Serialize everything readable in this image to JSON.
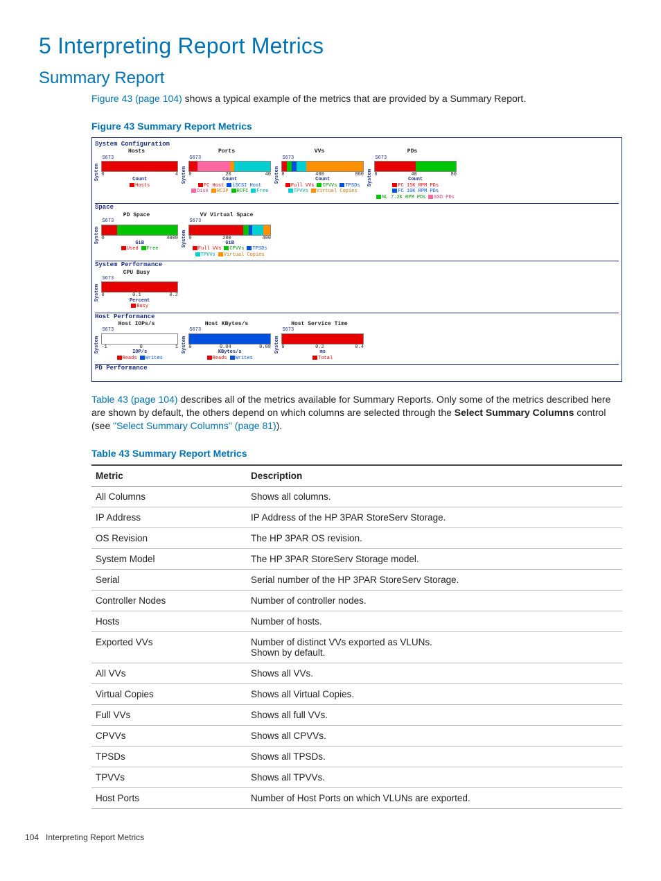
{
  "page": {
    "title": "5 Interpreting Report Metrics",
    "section": "Summary Report",
    "intro_link": "Figure 43 (page 104)",
    "intro_rest": " shows a typical example of the metrics that are provided by a Summary Report.",
    "figure_label": "Figure 43 Summary Report Metrics",
    "mid_link": "Table 43 (page 104)",
    "mid_rest": " describes all of the metrics available for Summary Reports. Only some of the metrics described here are shown by default, the others depend on which columns are selected through the ",
    "mid_bold": "Select Summary Columns",
    "mid_after_bold": " control (see ",
    "mid_link2": "\"Select Summary Columns\" (page 81)",
    "mid_close": ").",
    "table_label": "Table 43 Summary Report Metrics",
    "footer_page": "104",
    "footer_text": "Interpreting Report Metrics"
  },
  "figure": {
    "sections": {
      "sysconf": "System Configuration",
      "space": "Space",
      "sysperf": "System Performance",
      "hostperf": "Host Performance",
      "pdperf": "PD Performance"
    },
    "ylabel": "System",
    "row_label": "S673",
    "hosts": {
      "title": "Hosts",
      "axis_label": "Count",
      "ticks": [
        "0",
        "4"
      ],
      "legend": [
        {
          "c": "red",
          "t": "Hosts"
        }
      ]
    },
    "ports": {
      "title": "Ports",
      "axis_label": "Count",
      "ticks": [
        "0",
        "20",
        "40"
      ],
      "legend": [
        {
          "c": "red",
          "t": "FC Host"
        },
        {
          "c": "blue",
          "t": "iSCSI Host"
        },
        {
          "c": "pink",
          "t": "Disk"
        },
        {
          "c": "orange",
          "t": "RCIP"
        },
        {
          "c": "green",
          "t": "RCFC"
        },
        {
          "c": "cyan",
          "t": "Free"
        }
      ]
    },
    "vvs": {
      "title": "VVs",
      "axis_label": "Count",
      "ticks": [
        "0",
        "400",
        "800"
      ],
      "legend": [
        {
          "c": "red",
          "t": "Full VVs"
        },
        {
          "c": "green",
          "t": "CPVVs"
        },
        {
          "c": "blue",
          "t": "TPSDs"
        },
        {
          "c": "cyan",
          "t": "TPVVs"
        },
        {
          "c": "orange",
          "t": "Virtual Copies"
        }
      ]
    },
    "pds": {
      "title": "PDs",
      "axis_label": "Count",
      "ticks": [
        "0",
        "40",
        "80"
      ],
      "legend": [
        {
          "c": "red",
          "t": "FC 15K RPM PDs"
        },
        {
          "c": "blue",
          "t": "FC 10K RPM PDs"
        },
        {
          "c": "green",
          "t": "NL 7.2K RPM PDs"
        },
        {
          "c": "pink",
          "t": "SSD PDs"
        }
      ]
    },
    "pdspace": {
      "title": "PD Space",
      "axis_label": "GiB",
      "ticks": [
        "0",
        "4000"
      ],
      "legend": [
        {
          "c": "red",
          "t": "Used"
        },
        {
          "c": "green",
          "t": "Free"
        }
      ]
    },
    "vvspace": {
      "title": "VV Virtual Space",
      "axis_label": "GiB",
      "ticks": [
        "0",
        "200",
        "400"
      ],
      "legend": [
        {
          "c": "red",
          "t": "Full VVs"
        },
        {
          "c": "green",
          "t": "CPVVs"
        },
        {
          "c": "blue",
          "t": "TPSDs"
        },
        {
          "c": "cyan",
          "t": "TPVVs"
        },
        {
          "c": "orange",
          "t": "Virtual Copies"
        }
      ]
    },
    "cpu": {
      "title": "CPU Busy",
      "axis_label": "Percent",
      "ticks": [
        "0",
        "0.1",
        "0.2"
      ],
      "legend": [
        {
          "c": "red",
          "t": "Busy"
        }
      ]
    },
    "hiops": {
      "title": "Host IOPs/s",
      "axis_label": "IOP/s",
      "ticks": [
        "-1",
        "0",
        "1"
      ],
      "legend": [
        {
          "c": "red",
          "t": "Reads"
        },
        {
          "c": "blue",
          "t": "Writes"
        }
      ]
    },
    "hkb": {
      "title": "Host KBytes/s",
      "axis_label": "KBytes/s",
      "ticks": [
        "0",
        "0.04",
        "0.08"
      ],
      "legend": [
        {
          "c": "red",
          "t": "Reads"
        },
        {
          "c": "blue",
          "t": "Writes"
        }
      ]
    },
    "hsvc": {
      "title": "Host Service Time",
      "axis_label": "ms",
      "ticks": [
        "0",
        "0.2",
        "0.4"
      ],
      "legend": [
        {
          "c": "red",
          "t": "Total"
        }
      ]
    }
  },
  "table": {
    "headers": {
      "metric": "Metric",
      "desc": "Description"
    },
    "rows": [
      {
        "m": "All Columns",
        "d": "Shows all columns."
      },
      {
        "m": "IP Address",
        "d": "IP Address of the HP 3PAR StoreServ Storage."
      },
      {
        "m": "OS Revision",
        "d": "The HP 3PAR OS revision."
      },
      {
        "m": "System Model",
        "d": "The HP 3PAR StoreServ Storage model."
      },
      {
        "m": "Serial",
        "d": "Serial number of the HP 3PAR StoreServ Storage."
      },
      {
        "m": "Controller Nodes",
        "d": "Number of controller nodes."
      },
      {
        "m": "Hosts",
        "d": "Number of hosts."
      },
      {
        "m": "Exported VVs",
        "d": "Number of distinct VVs exported as VLUNs.",
        "d2": "Shown by default."
      },
      {
        "m": "All VVs",
        "d": "Shows all VVs."
      },
      {
        "m": "Virtual Copies",
        "d": "Shows all Virtual Copies."
      },
      {
        "m": "Full VVs",
        "d": "Shows all full VVs."
      },
      {
        "m": "CPVVs",
        "d": "Shows all CPVVs."
      },
      {
        "m": "TPSDs",
        "d": "Shows all TPSDs."
      },
      {
        "m": "TPVVs",
        "d": "Shows all TPVVs."
      },
      {
        "m": "Host Ports",
        "d": "Number of Host Ports on which VLUNs are exported."
      }
    ]
  },
  "chart_data": [
    {
      "type": "bar",
      "title": "Hosts",
      "xlabel": "Count",
      "categories": [
        "S673"
      ],
      "series": [
        {
          "name": "Hosts",
          "values": [
            5
          ]
        }
      ],
      "xlim": [
        0,
        5
      ]
    },
    {
      "type": "bar",
      "title": "Ports",
      "xlabel": "Count",
      "categories": [
        "S673"
      ],
      "series": [
        {
          "name": "FC Host",
          "values": [
            4
          ]
        },
        {
          "name": "iSCSI Host",
          "values": [
            0
          ]
        },
        {
          "name": "Disk",
          "values": [
            16
          ]
        },
        {
          "name": "RCIP",
          "values": [
            2
          ]
        },
        {
          "name": "RCFC",
          "values": [
            0
          ]
        },
        {
          "name": "Free",
          "values": [
            18
          ]
        }
      ],
      "xlim": [
        0,
        40
      ]
    },
    {
      "type": "bar",
      "title": "VVs",
      "xlabel": "Count",
      "categories": [
        "S673"
      ],
      "series": [
        {
          "name": "Full VVs",
          "values": [
            50
          ]
        },
        {
          "name": "CPVVs",
          "values": [
            50
          ]
        },
        {
          "name": "TPSDs",
          "values": [
            50
          ]
        },
        {
          "name": "TPVVs",
          "values": [
            100
          ]
        },
        {
          "name": "Virtual Copies",
          "values": [
            600
          ]
        }
      ],
      "xlim": [
        0,
        900
      ]
    },
    {
      "type": "bar",
      "title": "PDs",
      "xlabel": "Count",
      "categories": [
        "S673"
      ],
      "series": [
        {
          "name": "FC 15K RPM PDs",
          "values": [
            40
          ]
        },
        {
          "name": "FC 10K RPM PDs",
          "values": [
            0
          ]
        },
        {
          "name": "NL 7.2K RPM PDs",
          "values": [
            40
          ]
        },
        {
          "name": "SSD PDs",
          "values": [
            0
          ]
        }
      ],
      "xlim": [
        0,
        80
      ]
    },
    {
      "type": "bar",
      "title": "PD Space",
      "xlabel": "GiB",
      "categories": [
        "S673"
      ],
      "series": [
        {
          "name": "Used",
          "values": [
            1200
          ]
        },
        {
          "name": "Free",
          "values": [
            4800
          ]
        }
      ],
      "xlim": [
        0,
        6000
      ]
    },
    {
      "type": "bar",
      "title": "VV Virtual Space",
      "xlabel": "GiB",
      "categories": [
        "S673"
      ],
      "series": [
        {
          "name": "Full VVs",
          "values": [
            300
          ]
        },
        {
          "name": "CPVVs",
          "values": [
            30
          ]
        },
        {
          "name": "TPSDs",
          "values": [
            20
          ]
        },
        {
          "name": "TPVVs",
          "values": [
            60
          ]
        },
        {
          "name": "Virtual Copies",
          "values": [
            40
          ]
        }
      ],
      "xlim": [
        0,
        460
      ]
    },
    {
      "type": "bar",
      "title": "CPU Busy",
      "xlabel": "Percent",
      "categories": [
        "S673"
      ],
      "series": [
        {
          "name": "Busy",
          "values": [
            0.27
          ]
        }
      ],
      "xlim": [
        0,
        0.27
      ]
    },
    {
      "type": "bar",
      "title": "Host IOPs/s",
      "xlabel": "IOP/s",
      "categories": [
        "S673"
      ],
      "series": [
        {
          "name": "Reads",
          "values": [
            0
          ]
        },
        {
          "name": "Writes",
          "values": [
            0
          ]
        }
      ],
      "xlim": [
        -1,
        1
      ]
    },
    {
      "type": "bar",
      "title": "Host KBytes/s",
      "xlabel": "KBytes/s",
      "categories": [
        "S673"
      ],
      "series": [
        {
          "name": "Reads",
          "values": [
            0
          ]
        },
        {
          "name": "Writes",
          "values": [
            0.09
          ]
        }
      ],
      "xlim": [
        0,
        0.09
      ]
    },
    {
      "type": "bar",
      "title": "Host Service Time",
      "xlabel": "ms",
      "categories": [
        "S673"
      ],
      "series": [
        {
          "name": "Total",
          "values": [
            0.45
          ]
        }
      ],
      "xlim": [
        0,
        0.45
      ]
    }
  ]
}
